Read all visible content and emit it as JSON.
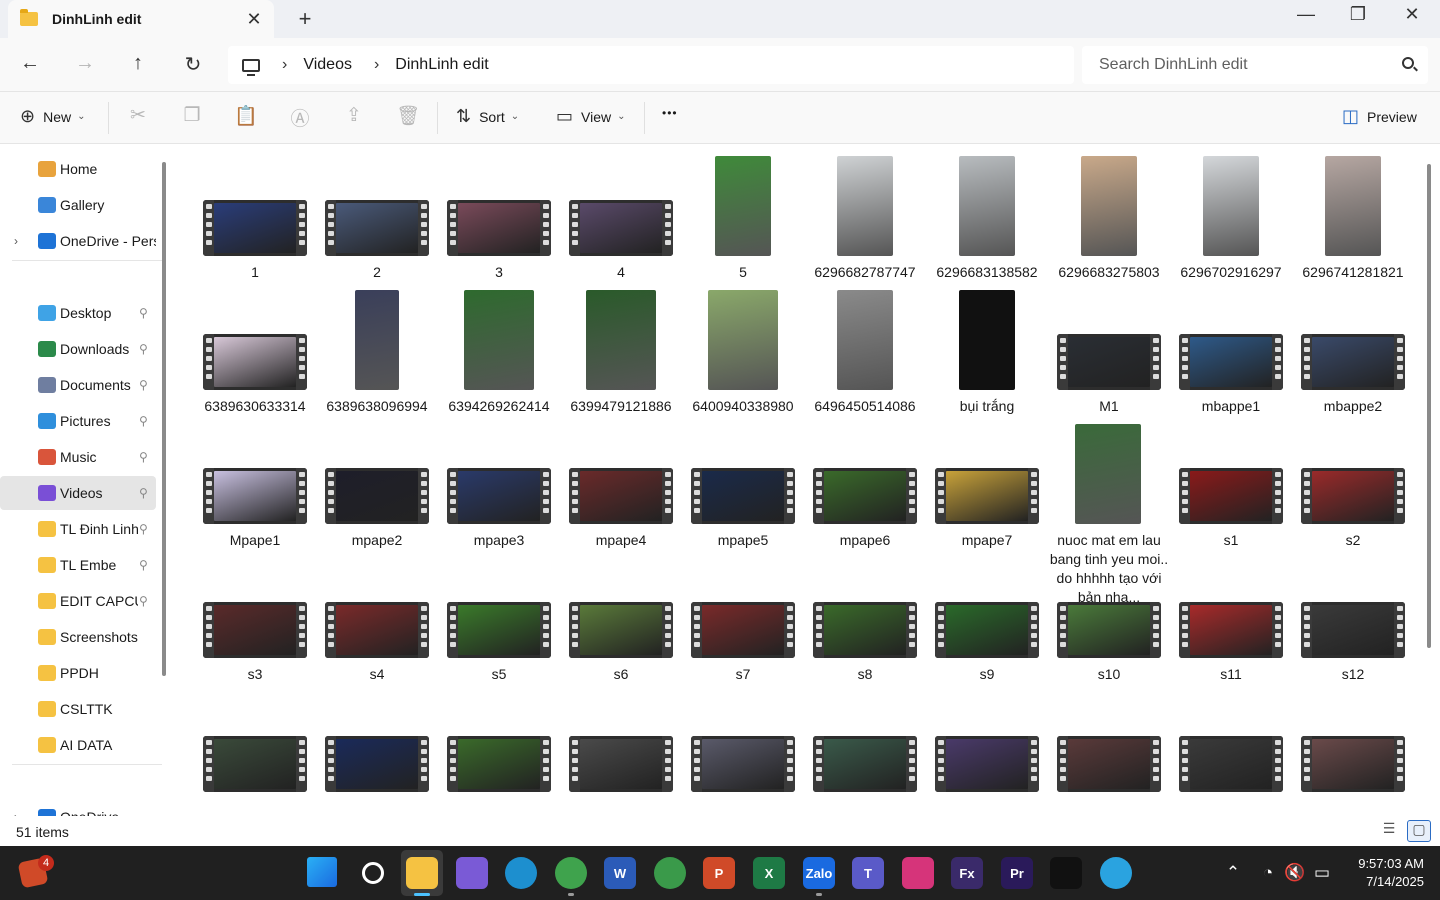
{
  "window": {
    "tab_title": "DinhLinh edit",
    "tab_close": "✕",
    "new_tab": "+",
    "minimize": "—",
    "maximize": "❐",
    "close": "✕"
  },
  "nav": {
    "back": "←",
    "forward": "→",
    "up": "↑",
    "refresh": "↻",
    "breadcrumb": [
      "Videos",
      "DinhLinh edit"
    ],
    "sep": "›",
    "search_placeholder": "Search DinhLinh edit"
  },
  "commands": {
    "new_label": "New",
    "sort_label": "Sort",
    "view_label": "View",
    "more": "•••",
    "preview_label": "Preview",
    "caret": "⌄"
  },
  "sidebar": {
    "items": [
      {
        "label": "Home",
        "icon": "home-icon",
        "color": "#e8a33d"
      },
      {
        "label": "Gallery",
        "icon": "gallery-icon",
        "color": "#3a86d9"
      },
      {
        "label": "OneDrive - Perso",
        "icon": "onedrive-icon",
        "color": "#1e73d6"
      },
      {
        "label": "Desktop",
        "icon": "desktop-icon",
        "color": "#3fa3e6"
      },
      {
        "label": "Downloads",
        "icon": "downloads-icon",
        "color": "#2b8a4a"
      },
      {
        "label": "Documents",
        "icon": "documents-icon",
        "color": "#6f7ea0"
      },
      {
        "label": "Pictures",
        "icon": "pictures-icon",
        "color": "#2f8fdc"
      },
      {
        "label": "Music",
        "icon": "music-icon",
        "color": "#d9553b"
      },
      {
        "label": "Videos",
        "icon": "videos-icon",
        "color": "#7a4fd6"
      },
      {
        "label": "TL Đinh Linh",
        "icon": "folder-icon",
        "color": "#f5c242"
      },
      {
        "label": "TL Embe",
        "icon": "folder-icon",
        "color": "#f5c242"
      },
      {
        "label": "EDIT CAPCUT",
        "icon": "folder-icon",
        "color": "#f5c242"
      },
      {
        "label": "Screenshots",
        "icon": "folder-icon",
        "color": "#f5c242"
      },
      {
        "label": "PPDH",
        "icon": "folder-icon",
        "color": "#f5c242"
      },
      {
        "label": "CSLTTK",
        "icon": "folder-icon",
        "color": "#f5c242"
      },
      {
        "label": "AI DATA",
        "icon": "folder-icon",
        "color": "#f5c242"
      },
      {
        "label": "OneDrive",
        "icon": "onedrive-icon",
        "color": "#1e73d6"
      }
    ],
    "pin": "📌",
    "chevron": "›"
  },
  "files": [
    {
      "name": "1",
      "kind": "wide",
      "color": "#2a3d7a"
    },
    {
      "name": "2",
      "kind": "wide",
      "color": "#4a5a7a"
    },
    {
      "name": "3",
      "kind": "wide",
      "color": "#7a4a5a"
    },
    {
      "name": "4",
      "kind": "wide",
      "color": "#5a4a6a"
    },
    {
      "name": "5",
      "kind": "tall",
      "color": "#3f8a3a"
    },
    {
      "name": "6296682787747",
      "kind": "tall",
      "color": "#cfd2d4"
    },
    {
      "name": "6296683138582",
      "kind": "tall",
      "color": "#b8bcbf"
    },
    {
      "name": "6296683275803",
      "kind": "tall",
      "color": "#c9a98a"
    },
    {
      "name": "6296702916297",
      "kind": "tall",
      "color": "#d4d7da"
    },
    {
      "name": "6296741281821",
      "kind": "tall",
      "color": "#b6a7a2"
    },
    {
      "name": "6389630633314",
      "kind": "wide",
      "color": "#d8c8d8"
    },
    {
      "name": "6389638096994",
      "kind": "tall",
      "color": "#3a3f5a"
    },
    {
      "name": "6394269262414",
      "kind": "tall",
      "color": "#2e6a2e"
    },
    {
      "name": "6399479121886",
      "kind": "tall",
      "color": "#2a5a2a"
    },
    {
      "name": "6400940338980",
      "kind": "tall",
      "color": "#8aa86a"
    },
    {
      "name": "6496450514086",
      "kind": "tall",
      "color": "#8a8a8a"
    },
    {
      "name": "bụi trắng",
      "kind": "tall",
      "color": "#111111"
    },
    {
      "name": "M1",
      "kind": "wide",
      "color": "#2a2e34"
    },
    {
      "name": "mbappe1",
      "kind": "wide",
      "color": "#2e5a8a"
    },
    {
      "name": "mbappe2",
      "kind": "wide",
      "color": "#3a4a6a"
    },
    {
      "name": "Mpape1",
      "kind": "wide",
      "color": "#c8c0e0"
    },
    {
      "name": "mpape2",
      "kind": "wide",
      "color": "#1e1e2a"
    },
    {
      "name": "mpape3",
      "kind": "wide",
      "color": "#2a3a6a"
    },
    {
      "name": "mpape4",
      "kind": "wide",
      "color": "#6a2a2a"
    },
    {
      "name": "mpape5",
      "kind": "wide",
      "color": "#1a2a4a"
    },
    {
      "name": "mpape6",
      "kind": "wide",
      "color": "#3a6a2a"
    },
    {
      "name": "mpape7",
      "kind": "wide",
      "color": "#c8a23a"
    },
    {
      "name": "nuoc mat em lau bang tinh yeu moi.. do hhhhh tạo với bản nhạ...",
      "kind": "tall",
      "color": "#3a6a3a"
    },
    {
      "name": "s1",
      "kind": "wide",
      "color": "#8a1a1a"
    },
    {
      "name": "s2",
      "kind": "wide",
      "color": "#9a2a2a"
    },
    {
      "name": "s3",
      "kind": "wide",
      "color": "#5a2a2a"
    },
    {
      "name": "s4",
      "kind": "wide",
      "color": "#7a2a2a"
    },
    {
      "name": "s5",
      "kind": "wide",
      "color": "#3a7a2a"
    },
    {
      "name": "s6",
      "kind": "wide",
      "color": "#5a7a3a"
    },
    {
      "name": "s7",
      "kind": "wide",
      "color": "#7a2a2a"
    },
    {
      "name": "s8",
      "kind": "wide",
      "color": "#3a6a2a"
    },
    {
      "name": "s9",
      "kind": "wide",
      "color": "#2a6a2a"
    },
    {
      "name": "s10",
      "kind": "wide",
      "color": "#4a7a3a"
    },
    {
      "name": "s11",
      "kind": "wide",
      "color": "#a82a2a"
    },
    {
      "name": "s12",
      "kind": "wide",
      "color": "#3a3a3a"
    },
    {
      "name": "",
      "kind": "wide",
      "color": "#3a4a3a"
    },
    {
      "name": "",
      "kind": "wide",
      "color": "#1a2a5a"
    },
    {
      "name": "",
      "kind": "wide",
      "color": "#3a6a2a"
    },
    {
      "name": "",
      "kind": "wide",
      "color": "#4a4a4a"
    },
    {
      "name": "",
      "kind": "wide",
      "color": "#5a5a6a"
    },
    {
      "name": "",
      "kind": "wide",
      "color": "#3a5a4a"
    },
    {
      "name": "",
      "kind": "wide",
      "color": "#4a3a6a"
    },
    {
      "name": "",
      "kind": "wide",
      "color": "#5a3a3a"
    },
    {
      "name": "",
      "kind": "wide",
      "color": "#3a3a3a"
    },
    {
      "name": "",
      "kind": "wide",
      "color": "#6a4a4a"
    }
  ],
  "status": {
    "count": "51 items"
  },
  "taskbar": {
    "notif_badge": "4",
    "apps": [
      {
        "name": "start",
        "label": "",
        "color": "#2a8cf0"
      },
      {
        "name": "search",
        "label": "",
        "color": "#202020"
      },
      {
        "name": "file-explorer",
        "label": "",
        "color": "#f5c242"
      },
      {
        "name": "copilot",
        "label": "",
        "color": "#7a5ad6"
      },
      {
        "name": "edge",
        "label": "",
        "color": "#1d8fcf"
      },
      {
        "name": "coccoc",
        "label": "",
        "color": "#3fa34d"
      },
      {
        "name": "word",
        "label": "W",
        "color": "#2b5bb8"
      },
      {
        "name": "chrome",
        "label": "",
        "color": "#3a9a4a"
      },
      {
        "name": "powerpoint",
        "label": "P",
        "color": "#d04a28"
      },
      {
        "name": "excel",
        "label": "X",
        "color": "#1e7a45"
      },
      {
        "name": "zalo",
        "label": "Zalo",
        "color": "#1a6ae0"
      },
      {
        "name": "teams",
        "label": "T",
        "color": "#5a5ac8"
      },
      {
        "name": "instagram",
        "label": "",
        "color": "#d6347a"
      },
      {
        "name": "imagej",
        "label": "Fx",
        "color": "#3a2a6a"
      },
      {
        "name": "premiere",
        "label": "Pr",
        "color": "#2a1a5a"
      },
      {
        "name": "capcut",
        "label": "",
        "color": "#111111"
      },
      {
        "name": "telegram",
        "label": "",
        "color": "#2aa3e0"
      }
    ],
    "time": "9:57:03 AM",
    "date": "7/14/2025"
  }
}
